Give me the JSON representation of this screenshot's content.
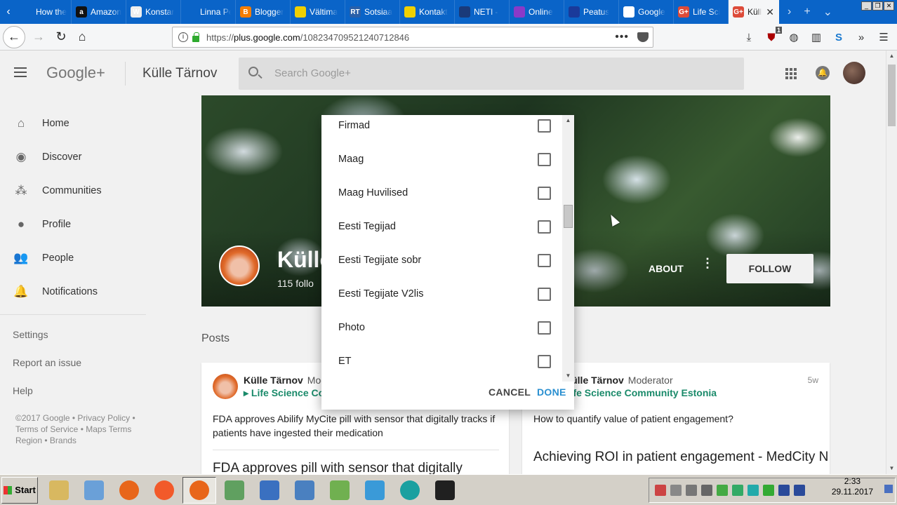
{
  "browser": {
    "tabs": [
      {
        "label": "How the Fu",
        "fav": "",
        "color": "#0a64c8"
      },
      {
        "label": "Amazon",
        "fav": "a",
        "color": "#111111"
      },
      {
        "label": "Konstar",
        "fav": "W",
        "color": "#eeeeee"
      },
      {
        "label": "Linna Pea!",
        "fav": "",
        "color": "#0a64c8"
      },
      {
        "label": "Blogger",
        "fav": "B",
        "color": "#f57d00"
      },
      {
        "label": "Vältima",
        "fav": "",
        "color": "#f0d000"
      },
      {
        "label": "Sotsiaa",
        "fav": "RT",
        "color": "#2a5fa8"
      },
      {
        "label": "Kontakt",
        "fav": "",
        "color": "#f0d000"
      },
      {
        "label": "NETI -",
        "fav": "",
        "color": "#1a3a7a"
      },
      {
        "label": "Online",
        "fav": "",
        "color": "#8a3ac8"
      },
      {
        "label": "Peatus",
        "fav": "",
        "color": "#1a3a9a"
      },
      {
        "label": "Google",
        "fav": "G",
        "color": "#ffffff"
      },
      {
        "label": "Life Sci",
        "fav": "G+",
        "color": "#dd4b39"
      }
    ],
    "active_tab": {
      "label": "Küll",
      "fav": "G+",
      "color": "#dd4b39",
      "close": "✕"
    },
    "url_prefix": "https://",
    "url_host": "plus.google.com",
    "url_path": "/108234709521240712846",
    "url_dots": "•••",
    "toolbar_icons": [
      "download-icon",
      "ublock-icon",
      "extension-icon",
      "sidebar-icon",
      "skype-icon",
      "overflow-icon",
      "menu-icon"
    ],
    "ublock_badge": "1"
  },
  "gplus": {
    "logo": "Google+",
    "page_name": "Külle Tärnov",
    "search_placeholder": "Search Google+"
  },
  "sidebar": {
    "items": [
      {
        "label": "Home",
        "icon": "home-icon",
        "glyph": "⌂"
      },
      {
        "label": "Discover",
        "icon": "compass-icon",
        "glyph": "◉"
      },
      {
        "label": "Communities",
        "icon": "communities-icon",
        "glyph": "⁂"
      },
      {
        "label": "Profile",
        "icon": "profile-icon",
        "glyph": "●"
      },
      {
        "label": "People",
        "icon": "people-icon",
        "glyph": "👥"
      },
      {
        "label": "Notifications",
        "icon": "bell-icon",
        "glyph": "🔔"
      }
    ],
    "links": [
      "Settings",
      "Report an issue",
      "Help"
    ],
    "footer": "©2017 Google • Privacy Policy • Terms of Service • Maps Terms Region • Brands"
  },
  "profile": {
    "name": "Külle",
    "followers": "115 follo",
    "about": "ABOUT",
    "follow": "FOLLOW",
    "more": "⋮"
  },
  "posts": {
    "label": "Posts",
    "cards": [
      {
        "author": "Külle Tärnov",
        "role": "Mod",
        "community": "▸ Life Science Co",
        "age": "",
        "text": "FDA approves Abilify MyCite pill with sensor that digitally tracks if patients have ingested their medication",
        "link_title": "FDA approves pill with sensor that digitally"
      },
      {
        "author": "Külle Tärnov",
        "role": "Moderator",
        "community": "Life Science Community Estonia",
        "age": "5w",
        "text": "How to quantify value of patient engagement?",
        "link_title": "Achieving ROI in patient engagement - MedCity N"
      }
    ]
  },
  "dialog": {
    "items": [
      {
        "label": "Firmad",
        "checked": false
      },
      {
        "label": "Maag",
        "checked": false
      },
      {
        "label": "Maag Huvilised",
        "checked": false
      },
      {
        "label": "Eesti Tegijad",
        "checked": false
      },
      {
        "label": "Eesti Tegijate sobr",
        "checked": false
      },
      {
        "label": "Eesti Tegijate V2lis",
        "checked": false
      },
      {
        "label": "Photo",
        "checked": false
      },
      {
        "label": "ET",
        "checked": false
      }
    ],
    "cancel": "CANCEL",
    "done": "DONE",
    "accent": "#2a8fd0"
  },
  "taskbar": {
    "start": "Start",
    "apps": [
      {
        "name": "file-manager-icon",
        "color": "#d8b860"
      },
      {
        "name": "media-player-icon",
        "color": "#6aa0d8"
      },
      {
        "name": "firefox-icon",
        "color": "#e8661a"
      },
      {
        "name": "avast-icon",
        "color": "#f25a2a"
      },
      {
        "name": "firefox-active-icon",
        "color": "#e8661a"
      },
      {
        "name": "installer-icon",
        "color": "#60a060"
      },
      {
        "name": "browser-icon",
        "color": "#3a70c0"
      },
      {
        "name": "network-icon",
        "color": "#4a80c0"
      },
      {
        "name": "spreadsheet-icon",
        "color": "#70b050"
      },
      {
        "name": "windows-icon",
        "color": "#3a9ad8"
      },
      {
        "name": "eset-icon",
        "color": "#1aa0a0"
      },
      {
        "name": "record-icon",
        "color": "#202020"
      }
    ],
    "time": "2:33",
    "date": "29.11.2017"
  }
}
